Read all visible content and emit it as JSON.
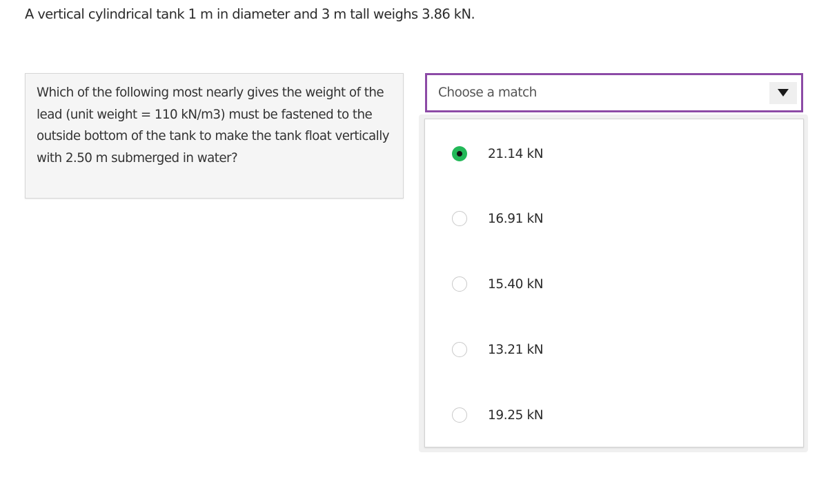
{
  "problem": {
    "intro": "A vertical cylindrical tank 1 m in diameter and 3 m tall weighs 3.86 kN.",
    "question": "Which of the following most nearly gives the weight of the lead (unit weight = 110 kN/m3) must be fastened to the outside bottom of the tank to make the tank float vertically with 2.50 m submerged in water?"
  },
  "match_select": {
    "placeholder": "Choose a match",
    "icon": "triangle-down-icon",
    "border_color": "#8c4aa6"
  },
  "options": [
    {
      "label": "21.14 kN",
      "selected": true
    },
    {
      "label": "16.91 kN",
      "selected": false
    },
    {
      "label": "15.40 kN",
      "selected": false
    },
    {
      "label": "13.21 kN",
      "selected": false
    },
    {
      "label": "19.25 kN",
      "selected": false
    }
  ],
  "colors": {
    "selected_radio": "#22b858"
  }
}
